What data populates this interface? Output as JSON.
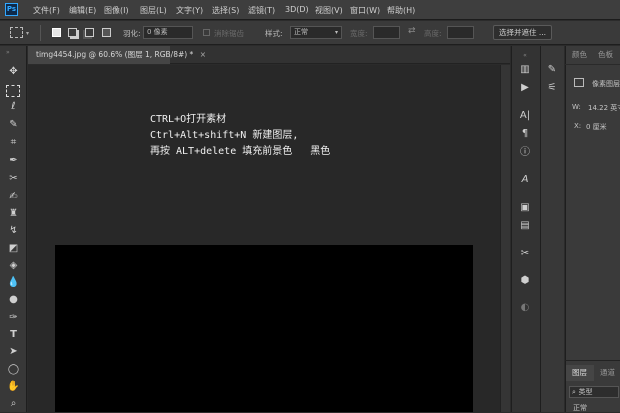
{
  "app": {
    "logo": "Ps"
  },
  "menu": [
    "文件(F)",
    "编辑(E)",
    "图像(I)",
    "图层(L)",
    "文字(Y)",
    "选择(S)",
    "滤镜(T)",
    "3D(D)",
    "视图(V)",
    "窗口(W)",
    "帮助(H)"
  ],
  "options": {
    "feather_label": "羽化:",
    "feather_value": "0 像素",
    "antialias_label": "消除锯齿",
    "style_label": "样式:",
    "style_value": "正常",
    "width_label": "宽度:",
    "height_label": "高度:",
    "select_mask_button": "选择并遮住 ..."
  },
  "document": {
    "tab_title": "timg4454.jpg @ 60.6% (图层 1, RGB/8#) *",
    "instructions": [
      "CTRL+O打开素材",
      "Ctrl+Alt+shift+N 新建图层,",
      "再按 ALT+delete 填充前景色   黑色"
    ]
  },
  "right_panel": {
    "tab_color": "颜色",
    "tab_swatches": "色板",
    "pixel_layer_label": "像素图层",
    "w_label": "W:",
    "w_value": "14.22 英寸",
    "x_label": "X:",
    "x_value": "0 厘米",
    "layers_tab": "图层",
    "channels_tab": "通道",
    "kind_filter": "类型",
    "mode_value": "正常"
  },
  "colors": {
    "accent": "#31a8ff",
    "canvas": "#000000",
    "workspace": "#282828"
  }
}
